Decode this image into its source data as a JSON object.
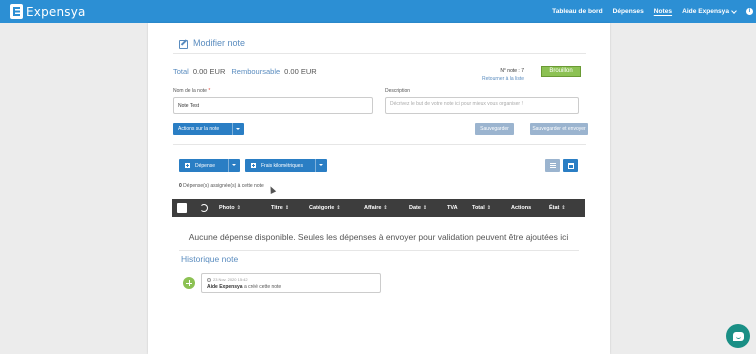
{
  "brand": {
    "name": "Expensya",
    "color": "#2c8fd4"
  },
  "nav": {
    "items": [
      {
        "label": "Tableau de bord"
      },
      {
        "label": "Dépenses"
      },
      {
        "label": "Notes",
        "active": true
      }
    ],
    "user_label": "Aide Expensya",
    "info_label": "i"
  },
  "page": {
    "title": "Modifier note",
    "total_label": "Total",
    "total_value": "0.00 EUR",
    "reimbursable_label": "Remboursable",
    "reimbursable_value": "0.00 EUR",
    "note_number": "N° note : 7",
    "back_link": "Retourner à la liste",
    "status_button": "Brouillon",
    "status_color": "#8cc153"
  },
  "form": {
    "name_label": "Nom de la note",
    "name_required": "*",
    "name_value": "Note Test",
    "description_label": "Description",
    "description_placeholder": "Décrivez le but de votre note ici pour mieux vous organiser !",
    "actions_button": "Actions sur la note",
    "save_button": "Sauvegarder",
    "save_send_button": "Sauvegarder et envoyer"
  },
  "expenses": {
    "add_expense_button": "Dépense",
    "mileage_button": "Frais kilométriques",
    "assigned_count": "0",
    "assigned_text": "Dépense(s) assignée(s) à cette note",
    "view_list_icon": "list-icon",
    "view_calendar_icon": "calendar-icon",
    "columns": [
      "Photo",
      "Titre",
      "Catégorie",
      "Affaire",
      "Date",
      "TVA",
      "Total",
      "Actions",
      "État"
    ],
    "sort_glyph": "⇕",
    "empty_message": "Aucune dépense disponible. Seules les dépenses à envoyer pour validation peuvent être ajoutées ici"
  },
  "history": {
    "title": "Historique note",
    "entries": [
      {
        "date": "23 Nov. 2020 15:42",
        "author": "Aide Expensya",
        "action": "a créé cette note"
      }
    ]
  },
  "chat": {
    "icon": "chat-icon",
    "color": "#1a8f85"
  }
}
